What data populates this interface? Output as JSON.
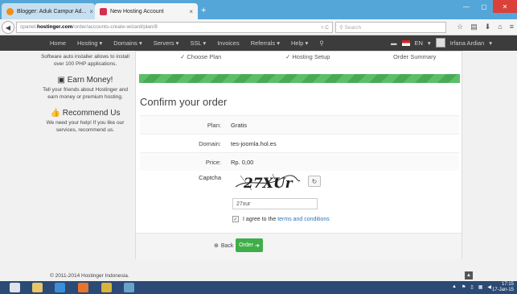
{
  "browser": {
    "tabs": [
      {
        "title": "Blogger: Aduk Campur Ad...",
        "active": false
      },
      {
        "title": "New Hosting Account",
        "active": true
      }
    ],
    "new_tab": "+",
    "url_prefix": "cpanel.",
    "url_domain": "hostinger.com",
    "url_path": "/order/accounts-create-wizard/plan/8",
    "search_placeholder": "Search",
    "icons": [
      "star-icon",
      "clipboard-icon",
      "download-icon",
      "home-icon",
      "menu-icon"
    ]
  },
  "site_header": {
    "menu": [
      "Home",
      "Hosting ▾",
      "Domains ▾",
      "Servers ▾",
      "SSL ▾",
      "Invoices",
      "Referrals ▾",
      "Help ▾"
    ],
    "language": "EN",
    "user": "Irfana Ardian"
  },
  "sidebar": {
    "intro": "Software auto installer allows to install over 100 PHP applications.",
    "earn_title": "Earn Money!",
    "earn_text": "Tell your friends about Hostinger and earn money or premium hosting.",
    "recommend_title": "Recommend Us",
    "recommend_text": "We need your help! If you like our services, recommend us."
  },
  "steps": [
    "✓ Choose Plan",
    "✓ Hosting Setup",
    "Order Summary"
  ],
  "order": {
    "title": "Confirm your order",
    "rows": [
      {
        "label": "Plan:",
        "value": "Gratis"
      },
      {
        "label": "Domain:",
        "value": "tes-joomla.hol.es"
      },
      {
        "label": "Price:",
        "value": "Rp. 0,00"
      }
    ],
    "captcha_label": "Captcha",
    "captcha_text": "27XUr",
    "captcha_value": "27xur",
    "agree_prefix": "I agree to the ",
    "agree_link": "terms and conditions",
    "back_label": "Back",
    "order_label": "Order"
  },
  "footer": {
    "copyright": "© 2011-2014 Hostinger Indonesia."
  },
  "taskbar": {
    "time": "17:15",
    "date": "17-Jan-15"
  }
}
